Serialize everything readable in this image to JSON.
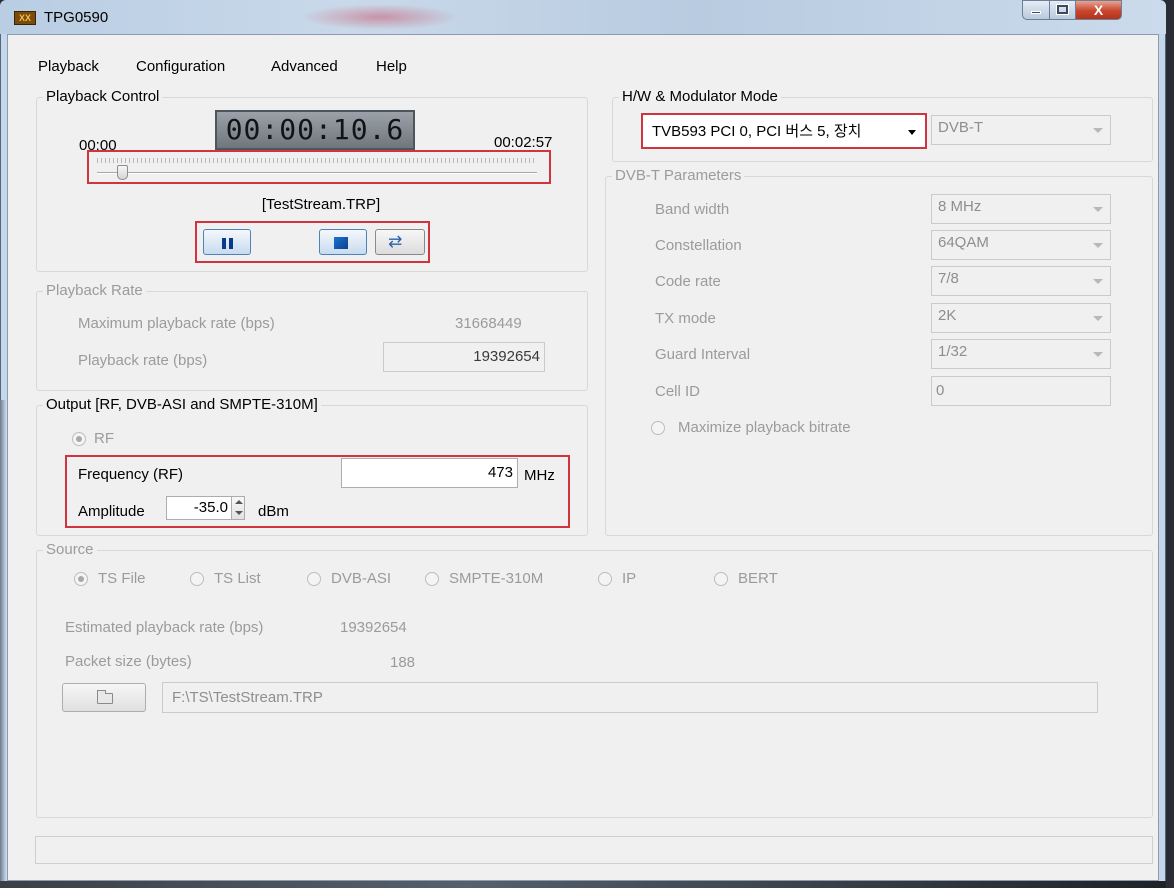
{
  "window": {
    "title": "TPG0590",
    "app_icon_text": "XX",
    "close_label": "X"
  },
  "menu": [
    "Playback",
    "Configuration",
    "Advanced",
    "Help"
  ],
  "playback_control": {
    "title": "Playback Control",
    "start_time": "00:00",
    "current_time": "00:00:10.6",
    "end_time": "00:02:57",
    "position_fraction": 0.06,
    "filename": "[TestStream.TRP]"
  },
  "playback_rate": {
    "title": "Playback Rate",
    "max_label": "Maximum playback rate (bps)",
    "max_value": "31668449",
    "rate_label": "Playback rate (bps)",
    "rate_value": "19392654"
  },
  "output": {
    "title": "Output [RF, DVB-ASI and SMPTE-310M]",
    "rf_label": "RF",
    "frequency_label": "Frequency (RF)",
    "frequency_value": "473",
    "frequency_unit": "MHz",
    "amplitude_label": "Amplitude",
    "amplitude_value": "-35.0",
    "amplitude_unit": "dBm"
  },
  "hw": {
    "title": "H/W & Modulator Mode",
    "device": "TVB593 PCI 0, PCI 버스 5, 장치",
    "mode": "DVB-T"
  },
  "dvbt": {
    "title": "DVB-T Parameters",
    "params": [
      {
        "label": "Band width",
        "value": "8 MHz"
      },
      {
        "label": "Constellation",
        "value": "64QAM"
      },
      {
        "label": "Code rate",
        "value": "7/8"
      },
      {
        "label": "TX mode",
        "value": "2K"
      },
      {
        "label": "Guard Interval",
        "value": "1/32"
      }
    ],
    "cell_id_label": "Cell ID",
    "cell_id_value": "0",
    "maximize_label": "Maximize playback bitrate"
  },
  "source": {
    "title": "Source",
    "options": [
      "TS File",
      "TS List",
      "DVB-ASI",
      "SMPTE-310M",
      "IP",
      "BERT"
    ],
    "selected": "TS File",
    "estimated_label": "Estimated playback rate (bps)",
    "estimated_value": "19392654",
    "packet_label": "Packet size (bytes)",
    "packet_value": "188",
    "file_path": "F:\\TS\\TestStream.TRP"
  },
  "colors": {
    "highlight_border": "#d0343f",
    "disabled_text": "#9b9b9b"
  }
}
